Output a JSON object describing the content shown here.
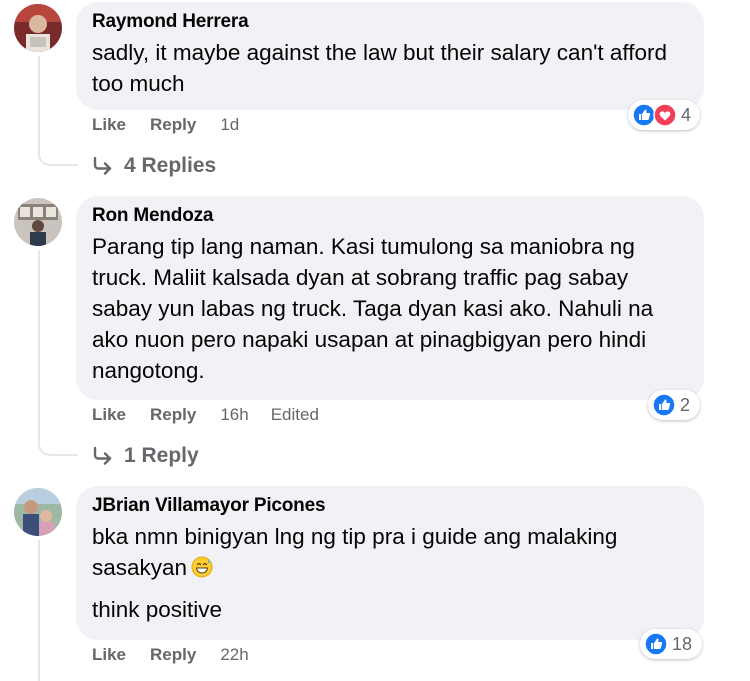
{
  "comments": [
    {
      "author": "Raymond Herrera",
      "text": "sadly, it maybe against the law but their salary can't afford too much",
      "reaction_count": "4",
      "reactions": [
        "like-icon",
        "love-icon"
      ],
      "like": "Like",
      "reply": "Reply",
      "time": "1d",
      "replies_link": "4 Replies"
    },
    {
      "author": "Ron Mendoza",
      "text": "Parang tip lang naman. Kasi tumulong sa maniobra ng truck. Maliit kalsada dyan at sobrang traffic pag sabay sabay yun labas ng truck. Taga dyan kasi ako. Nahuli na ako nuon pero napaki usapan at pinagbigyan pero hindi nangotong.",
      "reaction_count": "2",
      "reactions": [
        "like-icon"
      ],
      "like": "Like",
      "reply": "Reply",
      "time": "16h",
      "edited": "Edited",
      "replies_link": "1 Reply"
    },
    {
      "author": "JBrian Villamayor Picones",
      "text": "bka nmn binigyan lng ng tip pra i guide ang malaking sasakyan",
      "text_emoji": "grinning-sweat-emoji",
      "text2": "think positive",
      "reaction_count": "18",
      "reactions": [
        "like-icon"
      ],
      "like": "Like",
      "reply": "Reply",
      "time": "22h"
    }
  ],
  "colors": {
    "bubble": "#f0f2f5",
    "secondary_text": "#65676b",
    "like_blue": "#1877f2",
    "love_red": "#f33e58"
  }
}
